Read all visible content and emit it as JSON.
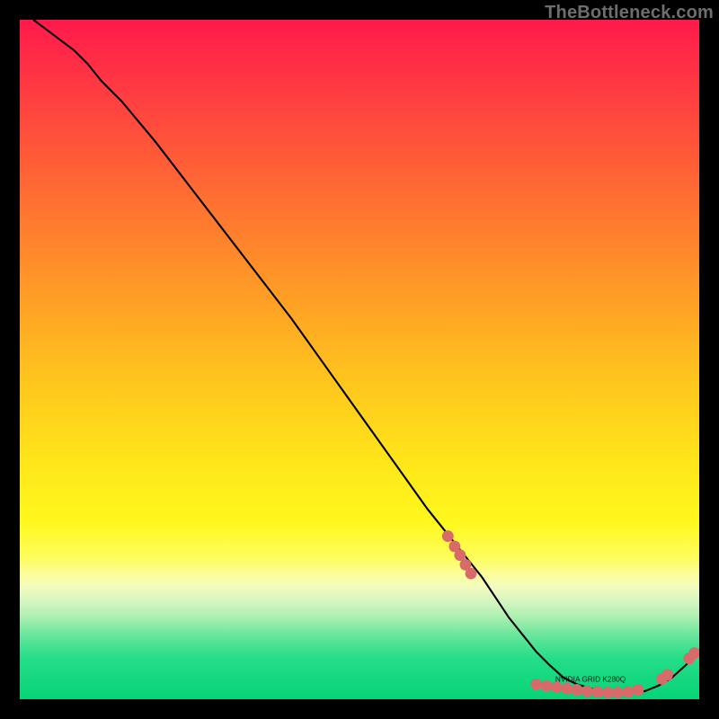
{
  "watermark": "TheBottleneck.com",
  "colors": {
    "marker": "#d86a6a",
    "line": "#000000",
    "tiny_label_fill": "#121212"
  },
  "gradient_stops": [
    {
      "pct": 0,
      "color": "#ff1a4b"
    },
    {
      "pct": 15,
      "color": "#ff4a3d"
    },
    {
      "pct": 35,
      "color": "#ff8b2a"
    },
    {
      "pct": 52,
      "color": "#ffc21e"
    },
    {
      "pct": 66,
      "color": "#ffe81a"
    },
    {
      "pct": 74,
      "color": "#fff81e"
    },
    {
      "pct": 79,
      "color": "#fdfd5a"
    },
    {
      "pct": 81.5,
      "color": "#fcfd9a"
    },
    {
      "pct": 83.5,
      "color": "#f2fbc0"
    },
    {
      "pct": 85.5,
      "color": "#d6f6c0"
    },
    {
      "pct": 88,
      "color": "#a9efb0"
    },
    {
      "pct": 91,
      "color": "#5ee59a"
    },
    {
      "pct": 94,
      "color": "#24dd88"
    },
    {
      "pct": 100,
      "color": "#07d376"
    }
  ],
  "annotations": {
    "tiny_label": "NVIDIA GRID K280Q"
  },
  "chart_data": {
    "type": "line",
    "title": "",
    "xlabel": "",
    "ylabel": "",
    "xlim": [
      0,
      100
    ],
    "ylim": [
      0,
      100
    ],
    "grid": false,
    "legend": false,
    "series": [
      {
        "name": "curve",
        "x": [
          2,
          4,
          6,
          8,
          10,
          12,
          15,
          20,
          25,
          30,
          35,
          40,
          45,
          50,
          55,
          60,
          62,
          64,
          66,
          68,
          70,
          72,
          74,
          76,
          78,
          80,
          82,
          84,
          86,
          88,
          90,
          92,
          94,
          96,
          98,
          100
        ],
        "y": [
          100,
          98.5,
          97,
          95.5,
          93.5,
          91,
          88,
          82,
          75.5,
          69,
          62.5,
          56,
          49,
          42,
          35,
          28,
          25.5,
          23,
          20.5,
          18,
          15,
          12,
          9.5,
          7,
          5,
          3.2,
          2.2,
          1.6,
          1.2,
          1.0,
          1.0,
          1.2,
          2.0,
          3.2,
          5.0,
          7.2
        ]
      }
    ],
    "markers": [
      {
        "x": 63.0,
        "y": 24.0
      },
      {
        "x": 64.0,
        "y": 22.5
      },
      {
        "x": 64.8,
        "y": 21.2
      },
      {
        "x": 65.6,
        "y": 19.8
      },
      {
        "x": 66.4,
        "y": 18.5
      },
      {
        "x": 76.0,
        "y": 2.2
      },
      {
        "x": 77.5,
        "y": 2.0
      },
      {
        "x": 79.0,
        "y": 1.8
      },
      {
        "x": 80.5,
        "y": 1.6
      },
      {
        "x": 82.0,
        "y": 1.4
      },
      {
        "x": 83.5,
        "y": 1.2
      },
      {
        "x": 85.0,
        "y": 1.1
      },
      {
        "x": 86.5,
        "y": 1.0
      },
      {
        "x": 88.0,
        "y": 1.0
      },
      {
        "x": 89.5,
        "y": 1.1
      },
      {
        "x": 91.0,
        "y": 1.4
      },
      {
        "x": 94.5,
        "y": 3.0
      },
      {
        "x": 95.3,
        "y": 3.6
      },
      {
        "x": 98.5,
        "y": 6.0
      },
      {
        "x": 99.3,
        "y": 6.8
      }
    ]
  }
}
